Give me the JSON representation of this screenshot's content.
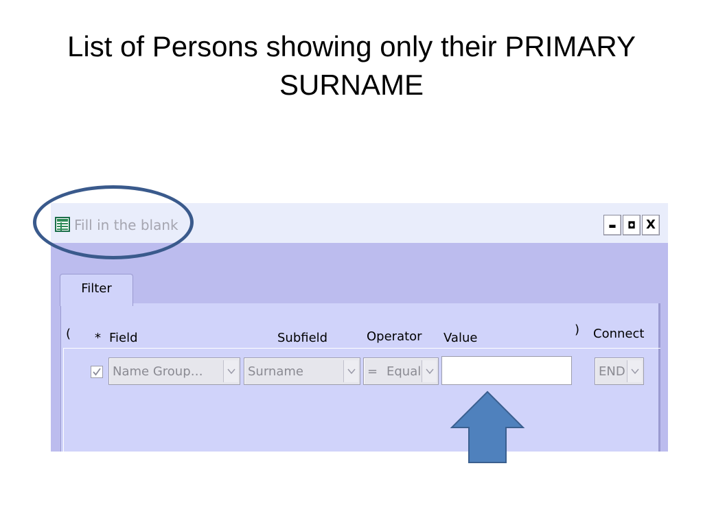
{
  "slide": {
    "title": "List of Persons showing only their PRIMARY SURNAME"
  },
  "window": {
    "title": "Fill in the blank",
    "icon": "grid-icon",
    "controls": {
      "minimize": "▬",
      "maximize": "◘",
      "close": "X"
    }
  },
  "tabs": [
    {
      "label": "Filter",
      "selected": true
    }
  ],
  "columns": {
    "open_paren": "(",
    "star": "*",
    "field": "Field",
    "subfield": "Subfield",
    "operator": "Operator",
    "value": "Value",
    "close_paren": ")",
    "connect": "Connect"
  },
  "row": {
    "checked": true,
    "field": "Name Group…",
    "subfield": "Surname",
    "operator_symbol": "=",
    "operator": "Equals",
    "value": "",
    "connect": "END"
  },
  "colors": {
    "dialog_bg": "#bcbcee",
    "panel_bg": "#d0d3fa",
    "titlebar_bg": "#e9edfb",
    "annotation_blue": "#3a5a8c",
    "arrow_fill": "#4f81bd"
  }
}
